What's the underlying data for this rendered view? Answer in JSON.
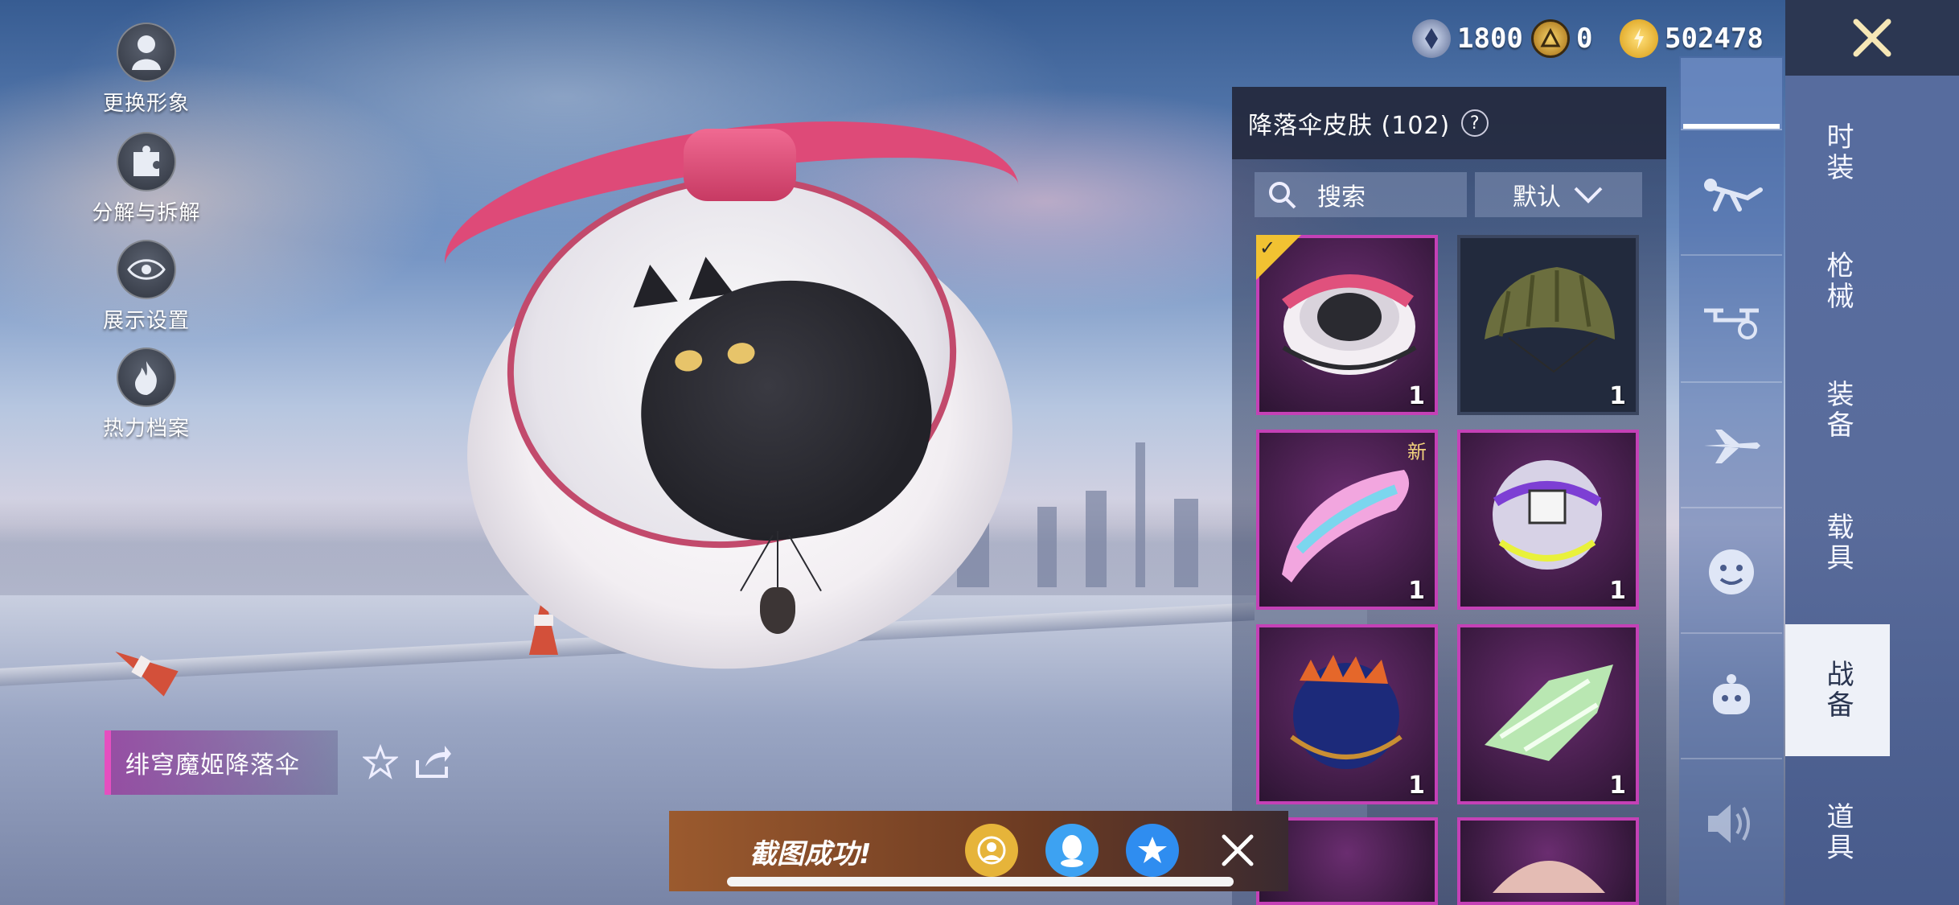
{
  "currencies": [
    {
      "icon": "silver-coin-icon",
      "value": "1800",
      "color": "#9aa8c9"
    },
    {
      "icon": "gold-medal-icon",
      "value": "0",
      "color": "#e2a92a"
    },
    {
      "icon": "bp-coin-icon",
      "value": "502478",
      "color": "#f0c23a"
    }
  ],
  "left_tools": [
    {
      "label": "更换形象",
      "icon": "avatar-icon"
    },
    {
      "label": "分解与拆解",
      "icon": "puzzle-icon"
    },
    {
      "label": "展示设置",
      "icon": "eye-icon"
    },
    {
      "label": "热力档案",
      "icon": "flame-icon"
    }
  ],
  "item": {
    "name": "绯穹魔姬降落伞"
  },
  "panel": {
    "title": "降落伞皮肤 (102)",
    "help": "?",
    "search_label": "搜索",
    "sort_label": "默认"
  },
  "grid": [
    {
      "qty": "1",
      "selected": true,
      "new": false,
      "style": "pink"
    },
    {
      "qty": "1",
      "selected": false,
      "new": false,
      "style": "plain"
    },
    {
      "qty": "1",
      "selected": false,
      "new": true,
      "new_label": "新",
      "style": "pink"
    },
    {
      "qty": "1",
      "selected": false,
      "new": false,
      "style": "pink"
    },
    {
      "qty": "1",
      "selected": false,
      "new": false,
      "style": "pink"
    },
    {
      "qty": "1",
      "selected": false,
      "new": false,
      "style": "pink"
    }
  ],
  "icon_tabs": [
    "skydive-icon",
    "drone-icon",
    "airplane-icon",
    "emote-icon",
    "companion-icon",
    "voice-icon"
  ],
  "category_tabs": [
    {
      "label": "时装",
      "active": false
    },
    {
      "label": "枪械",
      "active": false
    },
    {
      "label": "装备",
      "active": false
    },
    {
      "label": "载具",
      "active": false
    },
    {
      "label": "战备",
      "active": true
    },
    {
      "label": "道具",
      "active": false
    }
  ],
  "toast": {
    "text": "截图成功!"
  },
  "colors": {
    "accent_pink": "#c441b6",
    "panel_dark": "#232838",
    "active_tab": "#eef1f8"
  }
}
